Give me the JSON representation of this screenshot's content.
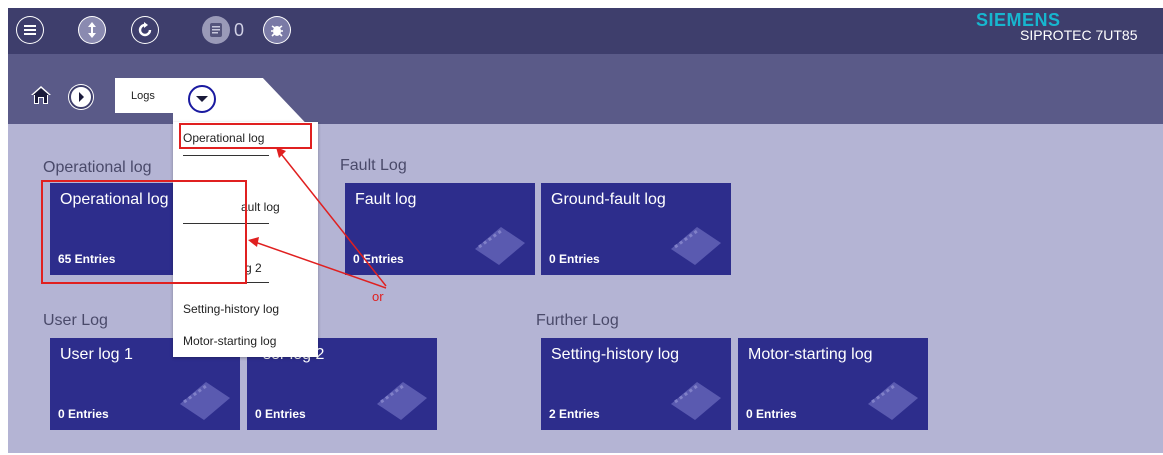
{
  "topbar": {
    "message_count": "0",
    "brand": "SIEMENS",
    "product": "SIPROTEC 7UT85"
  },
  "breadcrumb": {
    "current": "Logs"
  },
  "dropdown": {
    "items": [
      "Operational log",
      "ault log",
      "g 2",
      "Setting-history log",
      "Motor-starting log"
    ]
  },
  "groups": {
    "operational": "Operational log",
    "fault": "Fault Log",
    "user": "User Log",
    "further": "Further Log"
  },
  "tiles": [
    {
      "title": "Operational log",
      "count": "65 Entries"
    },
    {
      "title": "Fault log",
      "count": "0 Entries"
    },
    {
      "title": "Ground-fault log",
      "count": "0 Entries"
    },
    {
      "title": "User log 1",
      "count": "0 Entries"
    },
    {
      "title": "ser log 2",
      "count": "0 Entries"
    },
    {
      "title": "Setting-history log",
      "count": "2 Entries"
    },
    {
      "title": "Motor-starting log",
      "count": "0 Entries"
    }
  ],
  "annotation": {
    "label": "or",
    "color": "#e02020"
  },
  "colors": {
    "topbar": "#3e3e6c",
    "navbar": "#5a5a88",
    "background": "#b4b4d4",
    "tile": "#2d2d8c",
    "brand": "#17b6cf",
    "highlight": "#e02020"
  },
  "icons": {
    "menu": "hamburger-icon",
    "sync": "up-down-arrow-icon",
    "refresh": "refresh-icon",
    "messages": "message-icon",
    "test": "bug-icon",
    "home": "home-icon",
    "forward": "play-arrow-icon",
    "dropdown": "chevron-down-icon",
    "tile": "notebook-icon"
  }
}
